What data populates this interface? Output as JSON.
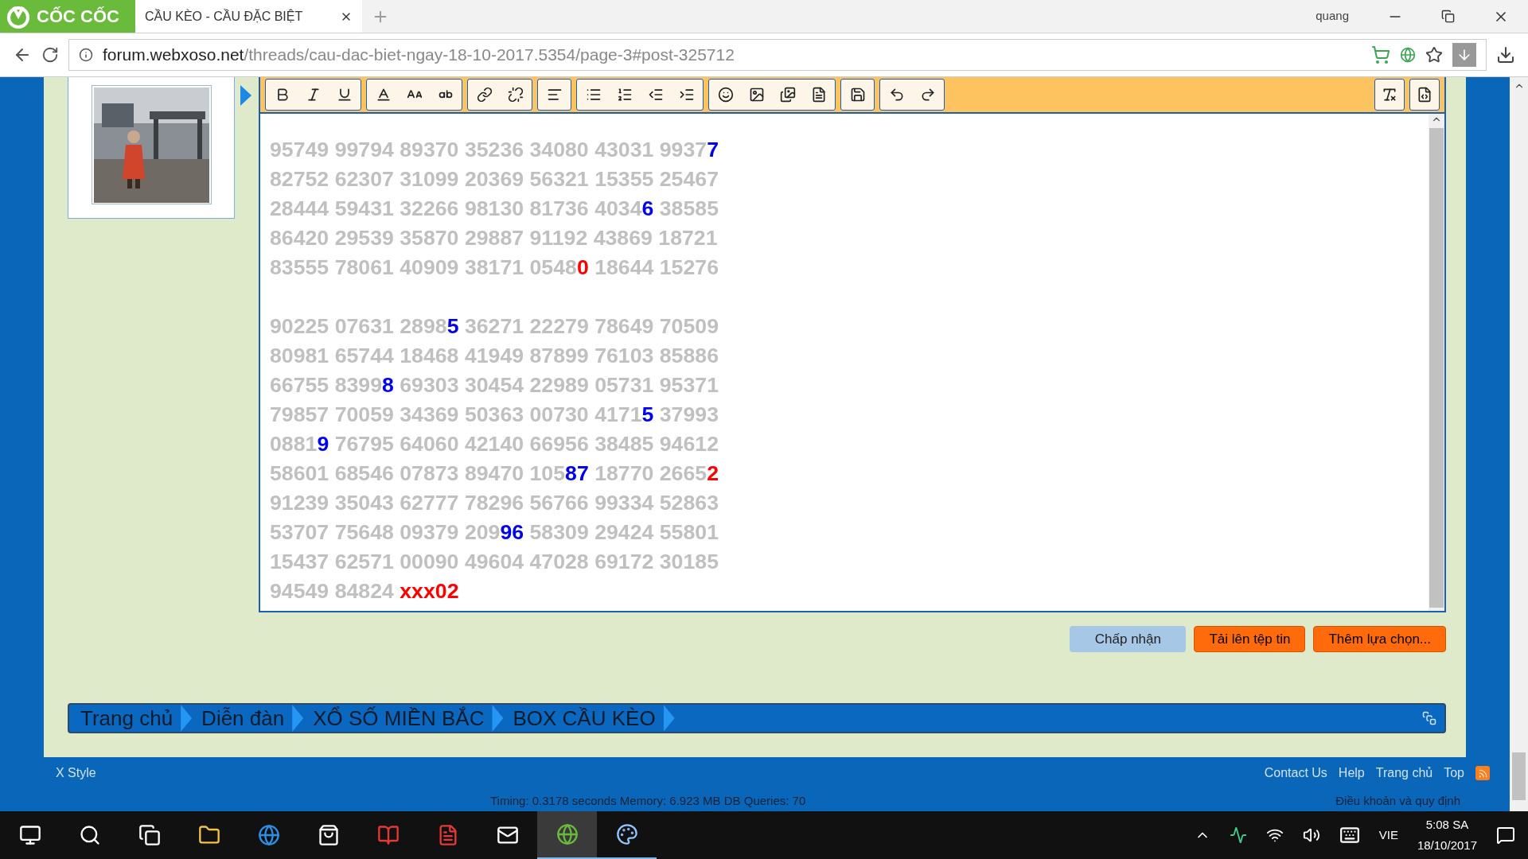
{
  "browser": {
    "brand": "CỐC CỐC",
    "tabs": [
      {
        "title": "CẦU KÈO - CẦU ĐẶC BIỆT",
        "selected": true
      }
    ],
    "user": "quang",
    "url": {
      "host": "forum.webxoso.net",
      "path": "/threads/cau-dac-biet-ngay-18-10-2017.5354/page-3#post-325712"
    }
  },
  "editor": {
    "blocks": [
      [
        [
          {
            "text": "95749 99794 89370 35236 34080 43031 9937",
            "color": "#c0c0c0"
          },
          {
            "text": "7",
            "color": "#0000ee"
          }
        ],
        [
          {
            "text": "82752 62307 31099 20369 56321 15355 25467",
            "color": "#c0c0c0"
          }
        ],
        [
          {
            "text": "28444 59431 32266 98130 81736 4034",
            "color": "#c0c0c0"
          },
          {
            "text": "6",
            "color": "#0000ee"
          },
          {
            "text": " 38585",
            "color": "#c0c0c0"
          }
        ],
        [
          {
            "text": "86420 29539 35870 29887 91192 43869 18721",
            "color": "#c0c0c0"
          }
        ],
        [
          {
            "text": "83555 78061 40909 38171 0548",
            "color": "#c0c0c0"
          },
          {
            "text": "0",
            "color": "#ff0000"
          },
          {
            "text": " 18644 15276",
            "color": "#c0c0c0"
          }
        ]
      ],
      [
        [
          {
            "text": "90225 07631 2898",
            "color": "#c0c0c0"
          },
          {
            "text": "5",
            "color": "#0000ee"
          },
          {
            "text": " 36271 22279 78649 70509",
            "color": "#c0c0c0"
          }
        ],
        [
          {
            "text": "80981 65744 18468 41949 87899 76103 85886",
            "color": "#c0c0c0"
          }
        ],
        [
          {
            "text": "66755 8399",
            "color": "#c0c0c0"
          },
          {
            "text": "8",
            "color": "#0000ee"
          },
          {
            "text": " 69303 30454 22989 05731 95371",
            "color": "#c0c0c0"
          }
        ],
        [
          {
            "text": "79857 70059 34369 50363 00730 4171",
            "color": "#c0c0c0"
          },
          {
            "text": "5",
            "color": "#0000ee"
          },
          {
            "text": " 37993",
            "color": "#c0c0c0"
          }
        ],
        [
          {
            "text": "0881",
            "color": "#c0c0c0"
          },
          {
            "text": "9",
            "color": "#0000ee"
          },
          {
            "text": " 76795 64060 42140 66956 38485 94612",
            "color": "#c0c0c0"
          }
        ],
        [
          {
            "text": "58601 68546 07873 89470 105",
            "color": "#c0c0c0"
          },
          {
            "text": "87",
            "color": "#0000ee"
          },
          {
            "text": " 18770 2665",
            "color": "#c0c0c0"
          },
          {
            "text": "2",
            "color": "#ff0000"
          }
        ],
        [
          {
            "text": "91239 35043 62777 78296 56766 99334 52863",
            "color": "#c0c0c0"
          }
        ],
        [
          {
            "text": "53707 75648 09379 209",
            "color": "#c0c0c0"
          },
          {
            "text": "96",
            "color": "#0000ee"
          },
          {
            "text": " 58309 29424 55801",
            "color": "#c0c0c0"
          }
        ],
        [
          {
            "text": "15437 62571 00090 49604 47028 69172 30185",
            "color": "#c0c0c0"
          }
        ],
        [
          {
            "text": "94549 84824 ",
            "color": "#c0c0c0"
          },
          {
            "text": "xxx02",
            "color": "#ff0000"
          }
        ]
      ]
    ]
  },
  "buttons": [
    {
      "label": "Chấp nhận",
      "kind": "primary"
    },
    {
      "label": "Tải lên tệp tin",
      "kind": "accent"
    },
    {
      "label": "Thêm lựa chọn...",
      "kind": "accent"
    }
  ],
  "breadcrumb": [
    "Trang chủ",
    "Diễn đàn",
    "XỔ SỐ MIỀN BẮC",
    "BOX CẦU KÈO"
  ],
  "footer": {
    "style": "X Style",
    "links": [
      "Contact Us",
      "Help",
      "Trang chủ",
      "Top"
    ],
    "timing": "Timing: 0.3178 seconds Memory: 6.923 MB DB Queries: 70",
    "terms": "Điều khoản và quy định"
  },
  "taskbar": {
    "language": "VIE",
    "time": "5:08 SA",
    "date": "18/10/2017"
  }
}
